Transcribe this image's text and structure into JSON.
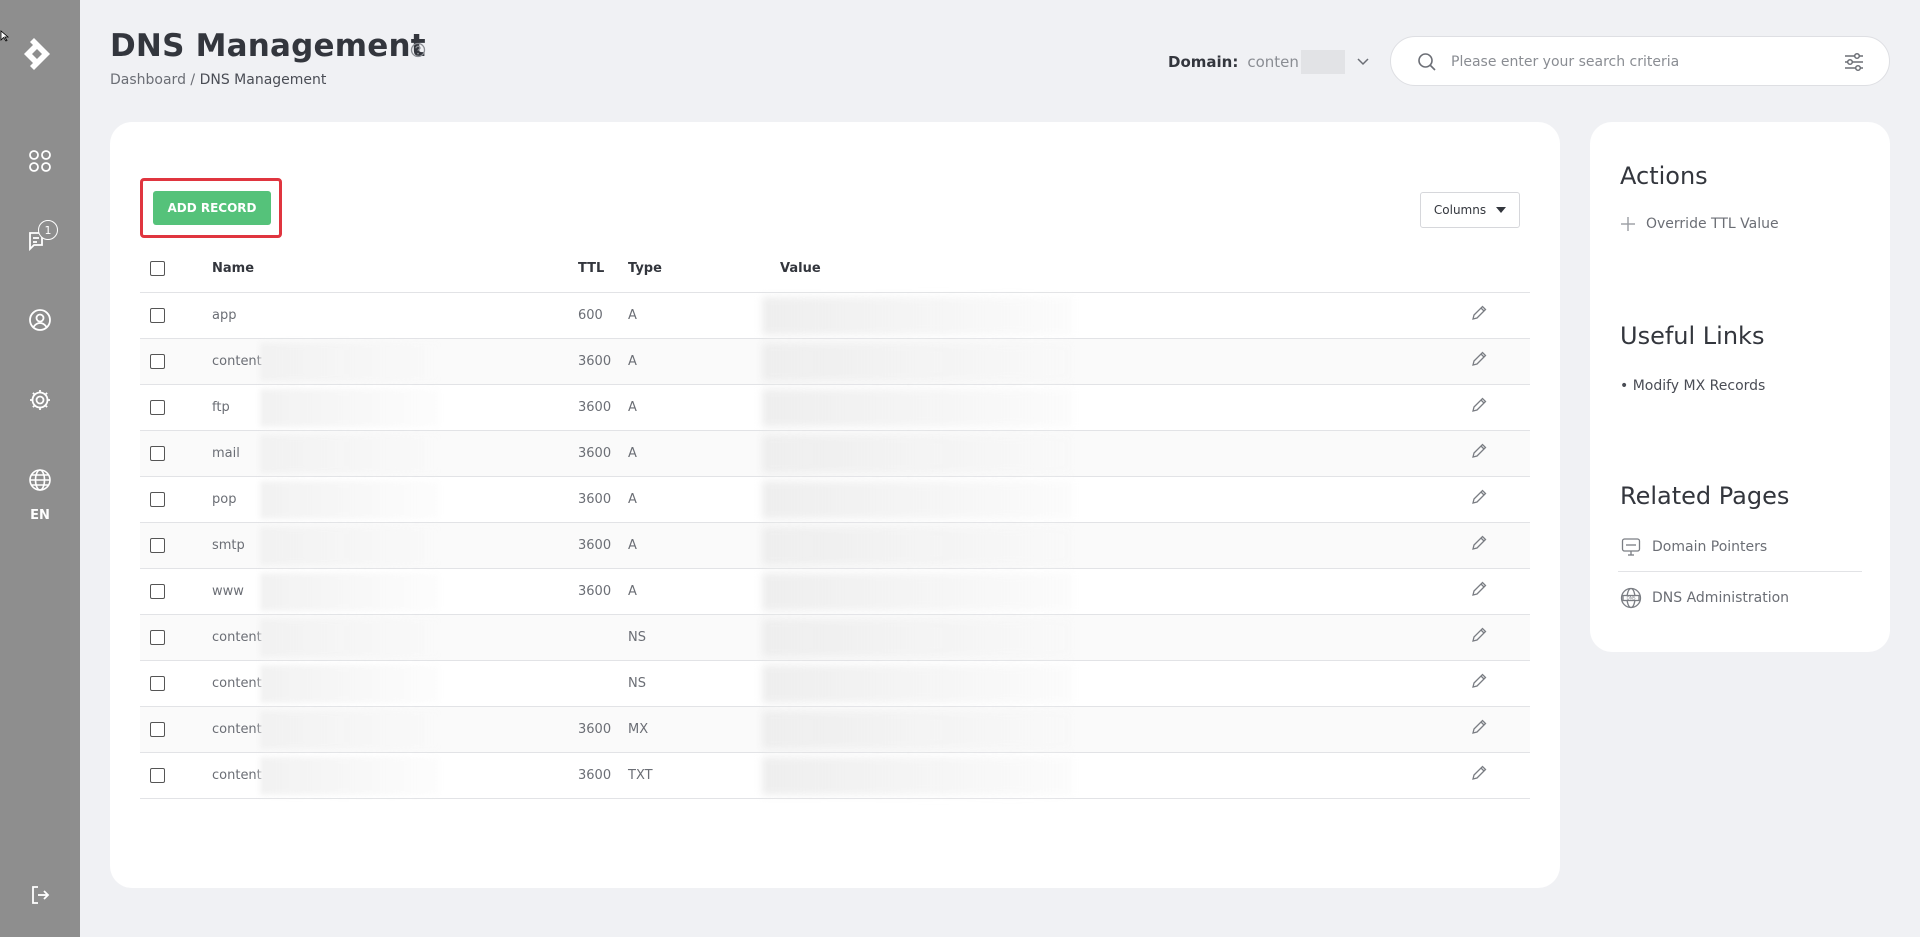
{
  "sidebar": {
    "notification_count": "1",
    "language": "EN"
  },
  "header": {
    "title": "DNS Management",
    "breadcrumb": {
      "root": "Dashboard",
      "separator": " / ",
      "current": "DNS Management"
    },
    "domain_label": "Domain:",
    "domain_value": "conten",
    "search_placeholder": "Please enter your search criteria"
  },
  "toolbar": {
    "add_record_label": "ADD RECORD",
    "columns_label": "Columns"
  },
  "table": {
    "headers": {
      "name": "Name",
      "ttl": "TTL",
      "type": "Type",
      "value": "Value"
    },
    "rows": [
      {
        "name": "app",
        "ttl": "600",
        "type": "A"
      },
      {
        "name": "content",
        "ttl": "3600",
        "type": "A"
      },
      {
        "name": "ftp",
        "ttl": "3600",
        "type": "A"
      },
      {
        "name": "mail",
        "ttl": "3600",
        "type": "A"
      },
      {
        "name": "pop",
        "ttl": "3600",
        "type": "A"
      },
      {
        "name": "smtp",
        "ttl": "3600",
        "type": "A"
      },
      {
        "name": "www",
        "ttl": "3600",
        "type": "A"
      },
      {
        "name": "content",
        "ttl": "",
        "type": "NS"
      },
      {
        "name": "content",
        "ttl": "",
        "type": "NS"
      },
      {
        "name": "content",
        "ttl": "3600",
        "type": "MX"
      },
      {
        "name": "content",
        "ttl": "3600",
        "type": "TXT"
      }
    ]
  },
  "side": {
    "actions_title": "Actions",
    "override_ttl_label": "Override TTL Value",
    "useful_links_title": "Useful Links",
    "mx_link_label": "• Modify MX Records",
    "related_title": "Related Pages",
    "domain_pointers_label": "Domain Pointers",
    "dns_admin_label": "DNS Administration"
  },
  "colors": {
    "sidebar": "#8e8e8e",
    "accent_green": "#55c27a",
    "highlight_red": "#e0353f",
    "background": "#f0f1f4"
  }
}
